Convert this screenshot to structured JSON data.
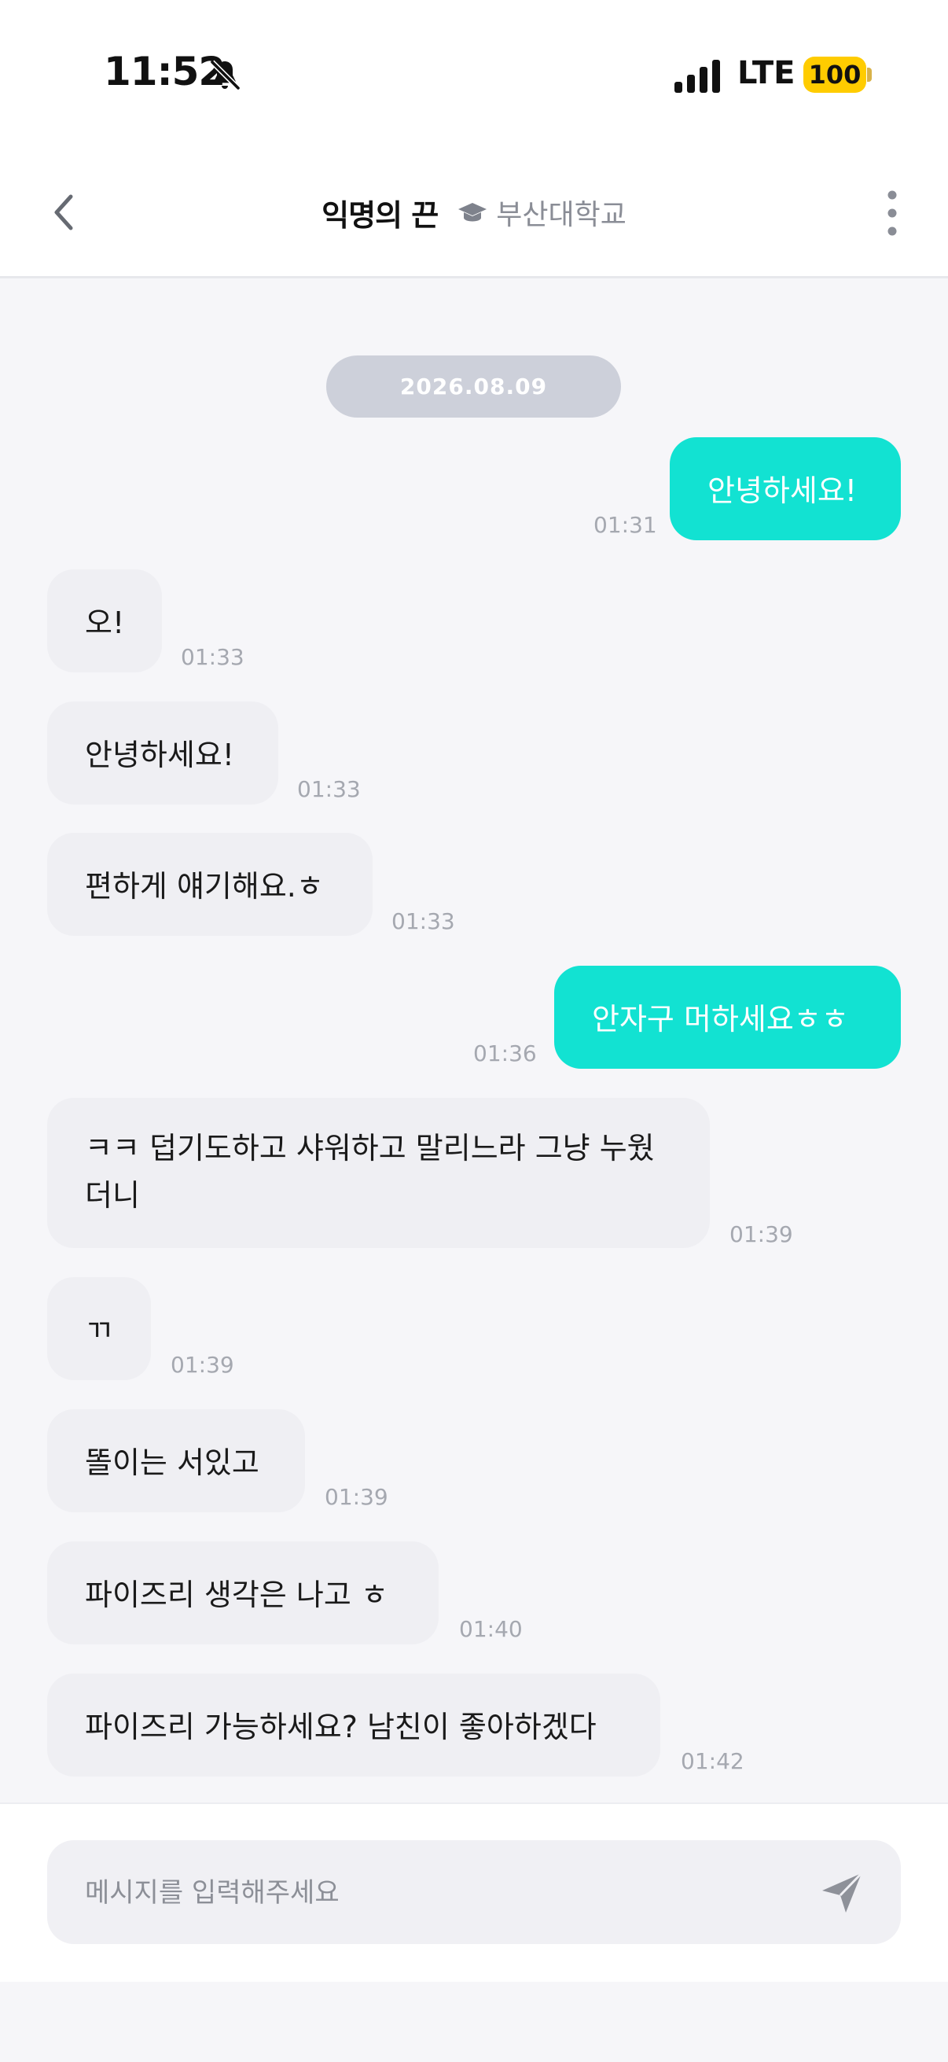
{
  "status_bar": {
    "time": "11:52",
    "network": "LTE",
    "battery": "100"
  },
  "header": {
    "title": "익명의 끈",
    "school": "부산대학교"
  },
  "chat": {
    "date": "2026.08.09",
    "messages": [
      {
        "dir": "out",
        "text": "안녕하세요!",
        "time": "01:31"
      },
      {
        "dir": "in",
        "text": "오!",
        "time": "01:33"
      },
      {
        "dir": "in",
        "text": "안녕하세요!",
        "time": "01:33"
      },
      {
        "dir": "in",
        "text": "편하게 얘기해요.ㅎ",
        "time": "01:33"
      },
      {
        "dir": "out",
        "text": "안자구 머하세요ㅎㅎ",
        "time": "01:36"
      },
      {
        "dir": "in",
        "text": "ㅋㅋ 덥기도하고 샤워하고 말리느라 그냥 누웠더니",
        "time": "01:39"
      },
      {
        "dir": "in",
        "text": "ㄲ",
        "time": "01:39"
      },
      {
        "dir": "in",
        "text": "똘이는 서있고",
        "time": "01:39"
      },
      {
        "dir": "in",
        "text": "파이즈리 생각은 나고 ㅎ",
        "time": "01:40"
      },
      {
        "dir": "in",
        "text": "파이즈리 가능하세요? 남친이 좋아하겠다",
        "time": "01:42"
      }
    ]
  },
  "composer": {
    "placeholder": "메시지를 입력해주세요"
  },
  "colors": {
    "outgoing_bubble": "#12E2D2",
    "incoming_bubble": "#EFEFF3",
    "date_pill": "#CDD0DA",
    "battery": "#FFCC00"
  },
  "icons": [
    "bell-off-icon",
    "signal-icon",
    "back-arrow-icon",
    "graduation-cap-icon",
    "more-vertical-icon",
    "send-icon"
  ]
}
